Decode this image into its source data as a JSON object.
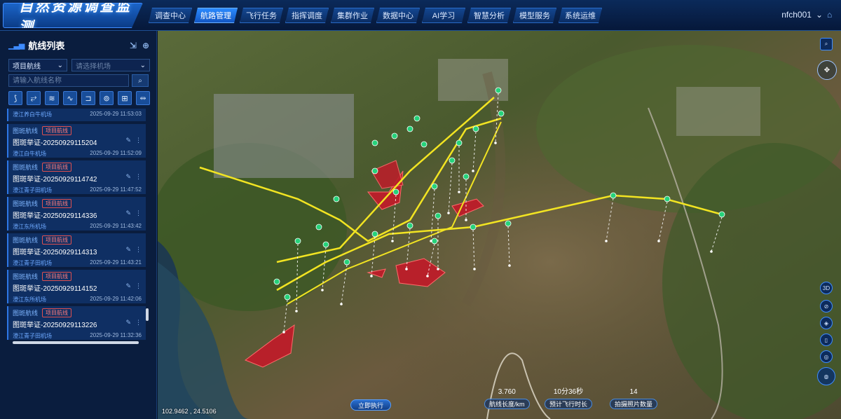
{
  "app": {
    "title": "自然资源调查监测"
  },
  "nav": [
    "调查中心",
    "航路管理",
    "飞行任务",
    "指挥调度",
    "集群作业",
    "数据中心",
    "AI学习",
    "智慧分析",
    "模型服务",
    "系统运维"
  ],
  "nav_active": 1,
  "user": {
    "name": "nfch001"
  },
  "sidebar": {
    "title": "航线列表",
    "filter1": "项目航线",
    "filter2_placeholder": "请选择机场",
    "search_placeholder": "请输入航线名称",
    "items": [
      {
        "tag": "",
        "badge": "",
        "name": "",
        "site": "澄江养白牛机场",
        "time": "2025-09-29 11:53:03"
      },
      {
        "tag": "图斑航线",
        "badge": "项目航线",
        "name": "图斑举证-20250929115204",
        "site": "澄江白牛机场",
        "time": "2025-09-29 11:52:09"
      },
      {
        "tag": "图斑航线",
        "badge": "项目航线",
        "name": "图斑举证-20250929114742",
        "site": "澄江青子田机场",
        "time": "2025-09-29 11:47:52"
      },
      {
        "tag": "图斑航线",
        "badge": "项目航线",
        "name": "图斑举证-20250929114336",
        "site": "澄江东所机场",
        "time": "2025-09-29 11:43:42"
      },
      {
        "tag": "图斑航线",
        "badge": "项目航线",
        "name": "图斑举证-20250929114313",
        "site": "澄江青子田机场",
        "time": "2025-09-29 11:43:21"
      },
      {
        "tag": "图斑航线",
        "badge": "项目航线",
        "name": "图斑举证-20250929114152",
        "site": "澄江东所机场",
        "time": "2025-09-29 11:42:06"
      },
      {
        "tag": "图斑航线",
        "badge": "项目航线",
        "name": "图斑举证-20250929113226",
        "site": "澄江青子田机场",
        "time": "2025-09-29 11:32:36"
      }
    ]
  },
  "map": {
    "coord": "102.9462 , 24.5106",
    "execute_label": "立即执行",
    "stats": [
      {
        "value": "3.760",
        "label": "航线长度/km"
      },
      {
        "value": "10分36秒",
        "label": "预计飞行时长"
      },
      {
        "value": "14",
        "label": "拍摄照片数量"
      }
    ],
    "controls": [
      "3D",
      "⊘",
      "◈",
      "▯",
      "◎"
    ]
  }
}
